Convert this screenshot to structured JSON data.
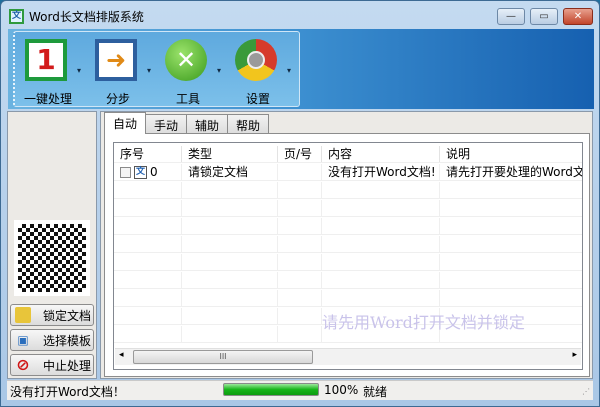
{
  "window": {
    "title": "Word长文档排版系统",
    "icon": "文",
    "min": "—",
    "max": "▭",
    "close": "✕"
  },
  "toolbar": {
    "buttons": [
      {
        "label": "一键处理",
        "icon": "one-key-icon",
        "glyph": "1"
      },
      {
        "label": "分步",
        "icon": "step-arrow-icon",
        "glyph": "➜"
      },
      {
        "label": "工具",
        "icon": "tools-icon",
        "glyph": "✕"
      },
      {
        "label": "设置",
        "icon": "settings-icon",
        "glyph": ""
      }
    ],
    "dropdown": "▾"
  },
  "sidebar": {
    "buttons": [
      {
        "label": "锁定文档",
        "icon": "lock-icon",
        "glyph": "🔒"
      },
      {
        "label": "选择模板",
        "icon": "template-icon",
        "glyph": "▣"
      },
      {
        "label": "中止处理",
        "icon": "stop-icon",
        "glyph": "⊘"
      }
    ]
  },
  "tabs": [
    {
      "label": "自动"
    },
    {
      "label": "手动"
    },
    {
      "label": "辅助"
    },
    {
      "label": "帮助"
    }
  ],
  "table": {
    "columns": [
      "序号",
      "类型",
      "页/号",
      "内容",
      "说明"
    ],
    "rows": [
      {
        "index": "0",
        "badge": "文",
        "type": "请锁定文档",
        "page": "",
        "content": "没有打开Word文档!",
        "note": "请先打开要处理的Word文档"
      }
    ]
  },
  "watermark": "请先用Word打开文档并锁定",
  "scrollbar": {
    "grip": "III",
    "left": "◂",
    "right": "▸"
  },
  "status": {
    "message": "没有打开Word文档！",
    "progress_percent": 100,
    "progress_text": "100%",
    "state": "就绪"
  }
}
